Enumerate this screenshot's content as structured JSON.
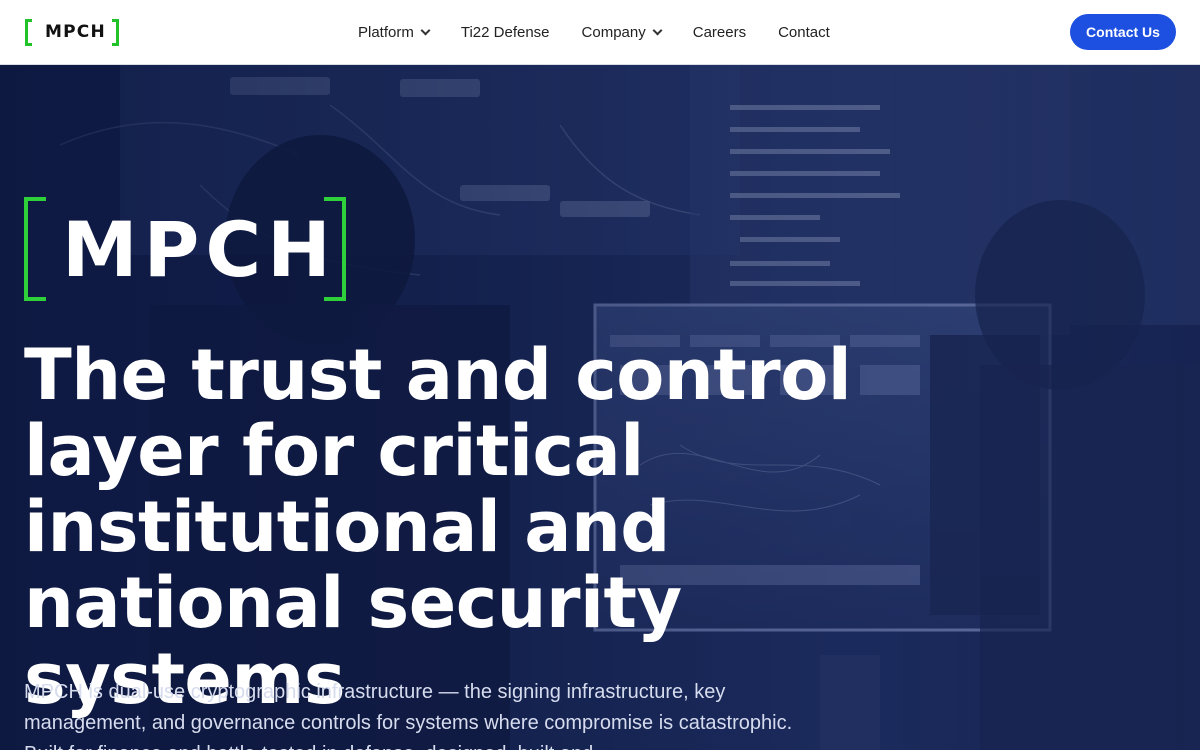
{
  "header": {
    "logo_text": "MPCH",
    "nav": [
      {
        "label": "Platform",
        "dropdown": true
      },
      {
        "label": "Ti22 Defense",
        "dropdown": false
      },
      {
        "label": "Company",
        "dropdown": true
      },
      {
        "label": "Careers",
        "dropdown": false
      },
      {
        "label": "Contact",
        "dropdown": false
      }
    ],
    "cta_label": "Contact Us"
  },
  "hero": {
    "logo_text": "MPCH",
    "headline": "The trust and control layer for critical institutional and national security systems",
    "subtext": "MPCH is dual-use cryptographic infrastructure — the signing infrastructure, key management, and governance controls for systems where compromise is catastrophic. Built for finance and battle-tested in defense, designed, built and"
  },
  "colors": {
    "accent_green": "#2fd13a",
    "cta_blue": "#1d4fe0",
    "hero_navy": "#1b2a5a"
  }
}
